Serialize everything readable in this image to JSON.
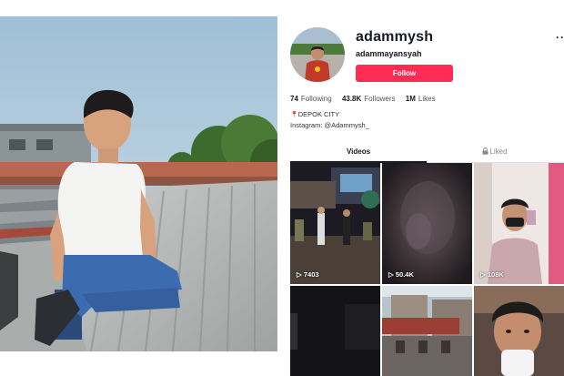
{
  "profile": {
    "username": "adammysh",
    "display_name": "adammayansyah",
    "follow_label": "Follow",
    "more_label": "···",
    "stats": [
      {
        "value": "74",
        "label": "Following"
      },
      {
        "value": "43.8K",
        "label": "Followers"
      },
      {
        "value": "1M",
        "label": "Likes"
      }
    ],
    "bio": {
      "location_pin": "📍",
      "location": "DEPOK CITY",
      "instagram": "Instagram: @Adammysh_"
    },
    "tabs": [
      {
        "label": "Videos",
        "active": true
      },
      {
        "label": "Liked",
        "icon": "lock-icon",
        "active": false
      }
    ],
    "videos": [
      {
        "views": "7403"
      },
      {
        "views": "50.4K"
      },
      {
        "views": "108K"
      },
      {
        "views": ""
      },
      {
        "views": ""
      },
      {
        "views": ""
      }
    ]
  },
  "colors": {
    "follow_button": "#fe2c55",
    "text_primary": "#161823",
    "text_secondary": "#8a8b91"
  }
}
